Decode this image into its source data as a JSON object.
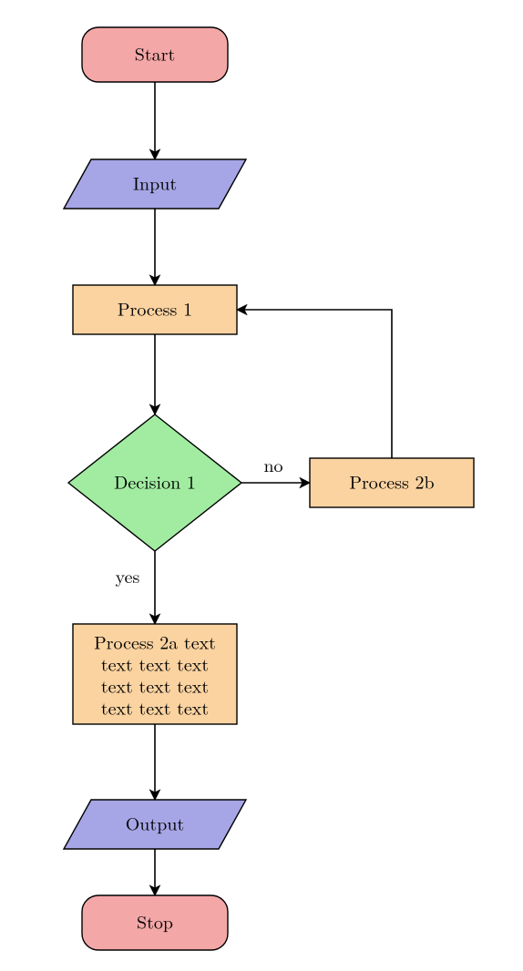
{
  "chart_data": {
    "type": "flowchart",
    "nodes": [
      {
        "id": "start",
        "type": "terminator",
        "label": "Start"
      },
      {
        "id": "input",
        "type": "io",
        "label": "Input"
      },
      {
        "id": "proc1",
        "type": "process",
        "label": "Process 1"
      },
      {
        "id": "dec1",
        "type": "decision",
        "label": "Decision 1"
      },
      {
        "id": "proc2a",
        "type": "process",
        "label_lines": [
          "Process 2a text",
          "text text text",
          "text text text",
          "text text text"
        ]
      },
      {
        "id": "proc2b",
        "type": "process",
        "label": "Process 2b"
      },
      {
        "id": "output",
        "type": "io",
        "label": "Output"
      },
      {
        "id": "stop",
        "type": "terminator",
        "label": "Stop"
      }
    ],
    "edges": [
      {
        "from": "start",
        "to": "input"
      },
      {
        "from": "input",
        "to": "proc1"
      },
      {
        "from": "proc1",
        "to": "dec1"
      },
      {
        "from": "dec1",
        "to": "proc2a",
        "label": "yes"
      },
      {
        "from": "dec1",
        "to": "proc2b",
        "label": "no"
      },
      {
        "from": "proc2b",
        "to": "proc1"
      },
      {
        "from": "proc2a",
        "to": "output"
      },
      {
        "from": "output",
        "to": "stop"
      }
    ],
    "colors": {
      "terminator_fill": "#f4a7a7",
      "io_fill": "#a6a6e6",
      "process_fill": "#fbd3a1",
      "decision_fill": "#a1eca1",
      "stroke": "#000000"
    }
  },
  "labels": {
    "start": "Start",
    "input": "Input",
    "proc1": "Process 1",
    "dec1": "Decision 1",
    "proc2a_l1": "Process 2a text",
    "proc2a_l2": "text text text",
    "proc2a_l3": "text text text",
    "proc2a_l4": "text text text",
    "proc2b": "Process 2b",
    "output": "Output",
    "stop": "Stop",
    "yes": "yes",
    "no": "no"
  }
}
